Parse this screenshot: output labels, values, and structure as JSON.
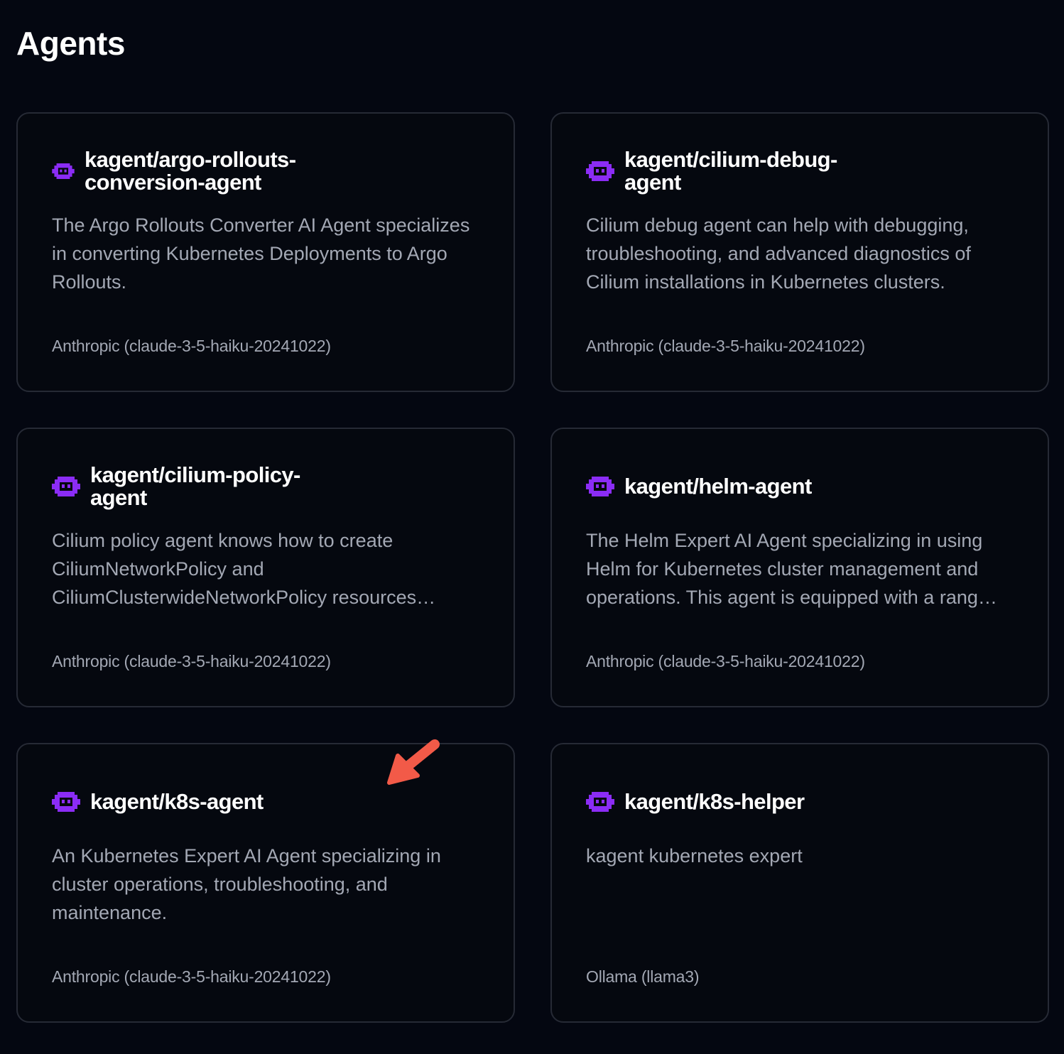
{
  "page": {
    "title": "Agents"
  },
  "colors": {
    "background": "#040711",
    "card_border": "#262a35",
    "icon": "#8b2cf5",
    "muted_text": "#a3a8b4",
    "arrow": "#f25a48"
  },
  "agents": [
    {
      "name": "kagent/argo-rollouts-conversion-agent",
      "icon": "robot-icon",
      "description": "The Argo Rollouts Converter AI Agent specializes in converting Kubernetes Deployments to Argo Rollouts.",
      "model": "Anthropic (claude-3-5-haiku-20241022)"
    },
    {
      "name": "kagent/cilium-debug-agent",
      "icon": "robot-icon",
      "description": "Cilium debug agent can help with debugging, troubleshooting, and advanced diagnostics of Cilium installations in Kubernetes clusters.",
      "model": "Anthropic (claude-3-5-haiku-20241022)"
    },
    {
      "name": "kagent/cilium-policy-agent",
      "icon": "robot-icon",
      "description": "Cilium policy agent knows how to create CiliumNetworkPolicy and CiliumClusterwideNetworkPolicy resources…",
      "model": "Anthropic (claude-3-5-haiku-20241022)"
    },
    {
      "name": "kagent/helm-agent",
      "icon": "robot-icon",
      "description": "The Helm Expert AI Agent specializing in using Helm for Kubernetes cluster management and operations. This agent is equipped with a rang…",
      "model": "Anthropic (claude-3-5-haiku-20241022)"
    },
    {
      "name": "kagent/k8s-agent",
      "icon": "robot-icon",
      "description": "An Kubernetes Expert AI Agent specializing in cluster operations, troubleshooting, and maintenance.",
      "model": "Anthropic (claude-3-5-haiku-20241022)"
    },
    {
      "name": "kagent/k8s-helper",
      "icon": "robot-icon",
      "description": "kagent kubernetes expert",
      "model": "Ollama (llama3)"
    }
  ]
}
